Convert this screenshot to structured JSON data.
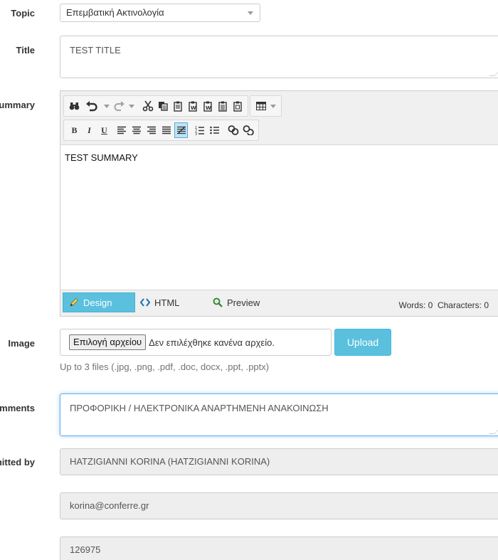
{
  "labels": {
    "topic": "Topic",
    "title": "Title",
    "summary": "Summary",
    "image": "Image",
    "comments": "Comments",
    "submitted_by": "Submitted by"
  },
  "topic": {
    "selected": "Επεμβατική Ακτινολογία"
  },
  "title_value": "TEST TITLE",
  "editor": {
    "content": "TEST SUMMARY",
    "tabs": {
      "design": "Design",
      "html": "HTML",
      "preview": "Preview"
    },
    "counter": "Words: 0  Characters: 0",
    "toolbar_row1": [
      "binoculars-icon",
      "undo-icon",
      "redo-icon",
      "cut-icon",
      "copy-icon",
      "paste-icon",
      "paste-text-icon",
      "paste-word-icon",
      "paste-word-clean-icon",
      "paste-html-icon",
      "paste-plain-icon",
      "table-icon"
    ],
    "toolbar_row2": [
      "B",
      "I",
      "U",
      "align-left-icon",
      "align-center-icon",
      "align-right-icon",
      "align-justify-icon",
      "clear-format-icon",
      "ordered-list-icon",
      "bullet-list-icon",
      "link-icon",
      "unlink-icon"
    ]
  },
  "file": {
    "choose_label": "Επιλογή αρχείου",
    "no_file_text": "Δεν επιλέχθηκε κανένα αρχείο.",
    "upload_label": "Upload",
    "help": "Up to 3 files (.jpg, .png, .pdf, .doc, docx, .ppt, .pptx)"
  },
  "comments_value": "ΠΡΟΦΟΡΙΚΗ / ΗΛΕΚΤΡΟΝΙΚΑ ΑΝΑΡΤΗΜΕΝΗ ΑΝΑΚΟΙΝΩΣΗ",
  "submitted_by": {
    "name": "HATZIGIANNI KORINA (HATZIGIANNI KORINA)",
    "email": "korina@conferre.gr",
    "code": "126975"
  },
  "colors": {
    "accent": "#5bc0de",
    "focus_border": "#66afe9",
    "readonly_bg": "#eeeeee"
  }
}
